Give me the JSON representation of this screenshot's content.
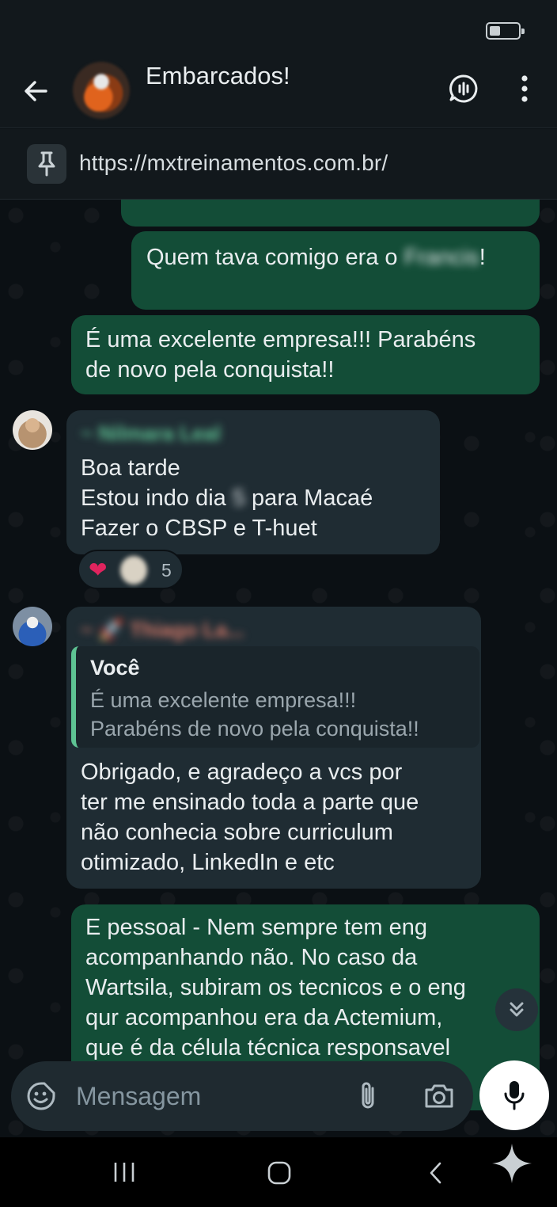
{
  "status_bar": {
    "battery_level": 0.35
  },
  "header": {
    "title": "Embarcados!",
    "back_icon": "arrow-left-icon",
    "voice_chat_icon": "voice-chat-icon",
    "menu_icon": "more-vertical-icon"
  },
  "pinned": {
    "icon": "pin-icon",
    "text": "https://mxtreinamentos.com.br/"
  },
  "messages": [
    {
      "text": "Quem tava comigo era o ",
      "redacted": "Francis",
      "trail": "!"
    },
    {
      "text": "É uma excelente empresa!!! Parabéns\nde novo pela conquista!!"
    },
    {
      "sender": "~ Nilmara Leal",
      "line1_pre": "Boa tarde",
      "line2_pre": "Estou indo dia ",
      "line2_redacted": "5",
      "line2_post": " para Macaé",
      "line3": "Fazer o CBSP e T-huet",
      "reaction_emoji": "❤",
      "reaction_count": "5"
    },
    {
      "sender": "~ 🚀 Thiago La...",
      "quote_name": "Você",
      "quote_text": "É uma excelente empresa!!!\nParabéns de novo pela conquista!!",
      "text": "Obrigado, e agradeço a vcs por\nter me ensinado toda a parte que\nnão conhecia sobre curriculum\notimizado, LinkedIn e etc"
    },
    {
      "text": "E pessoal - Nem sempre tem eng\nacompanhando não. No caso da\nWartsila, subiram os tecnicos e o eng\nqur acompanhou era da Actemium,\nque é da célula técnica responsavel"
    }
  ],
  "composer": {
    "placeholder": "Mensagem",
    "emoji_icon": "sticker-icon",
    "attach_icon": "paperclip-icon",
    "camera_icon": "camera-icon",
    "mic_icon": "microphone-icon"
  },
  "navbar": {
    "recents_icon": "recents-icon",
    "home_icon": "home-icon",
    "back_icon": "nav-back-icon",
    "assistant_icon": "sparkle-icon"
  }
}
